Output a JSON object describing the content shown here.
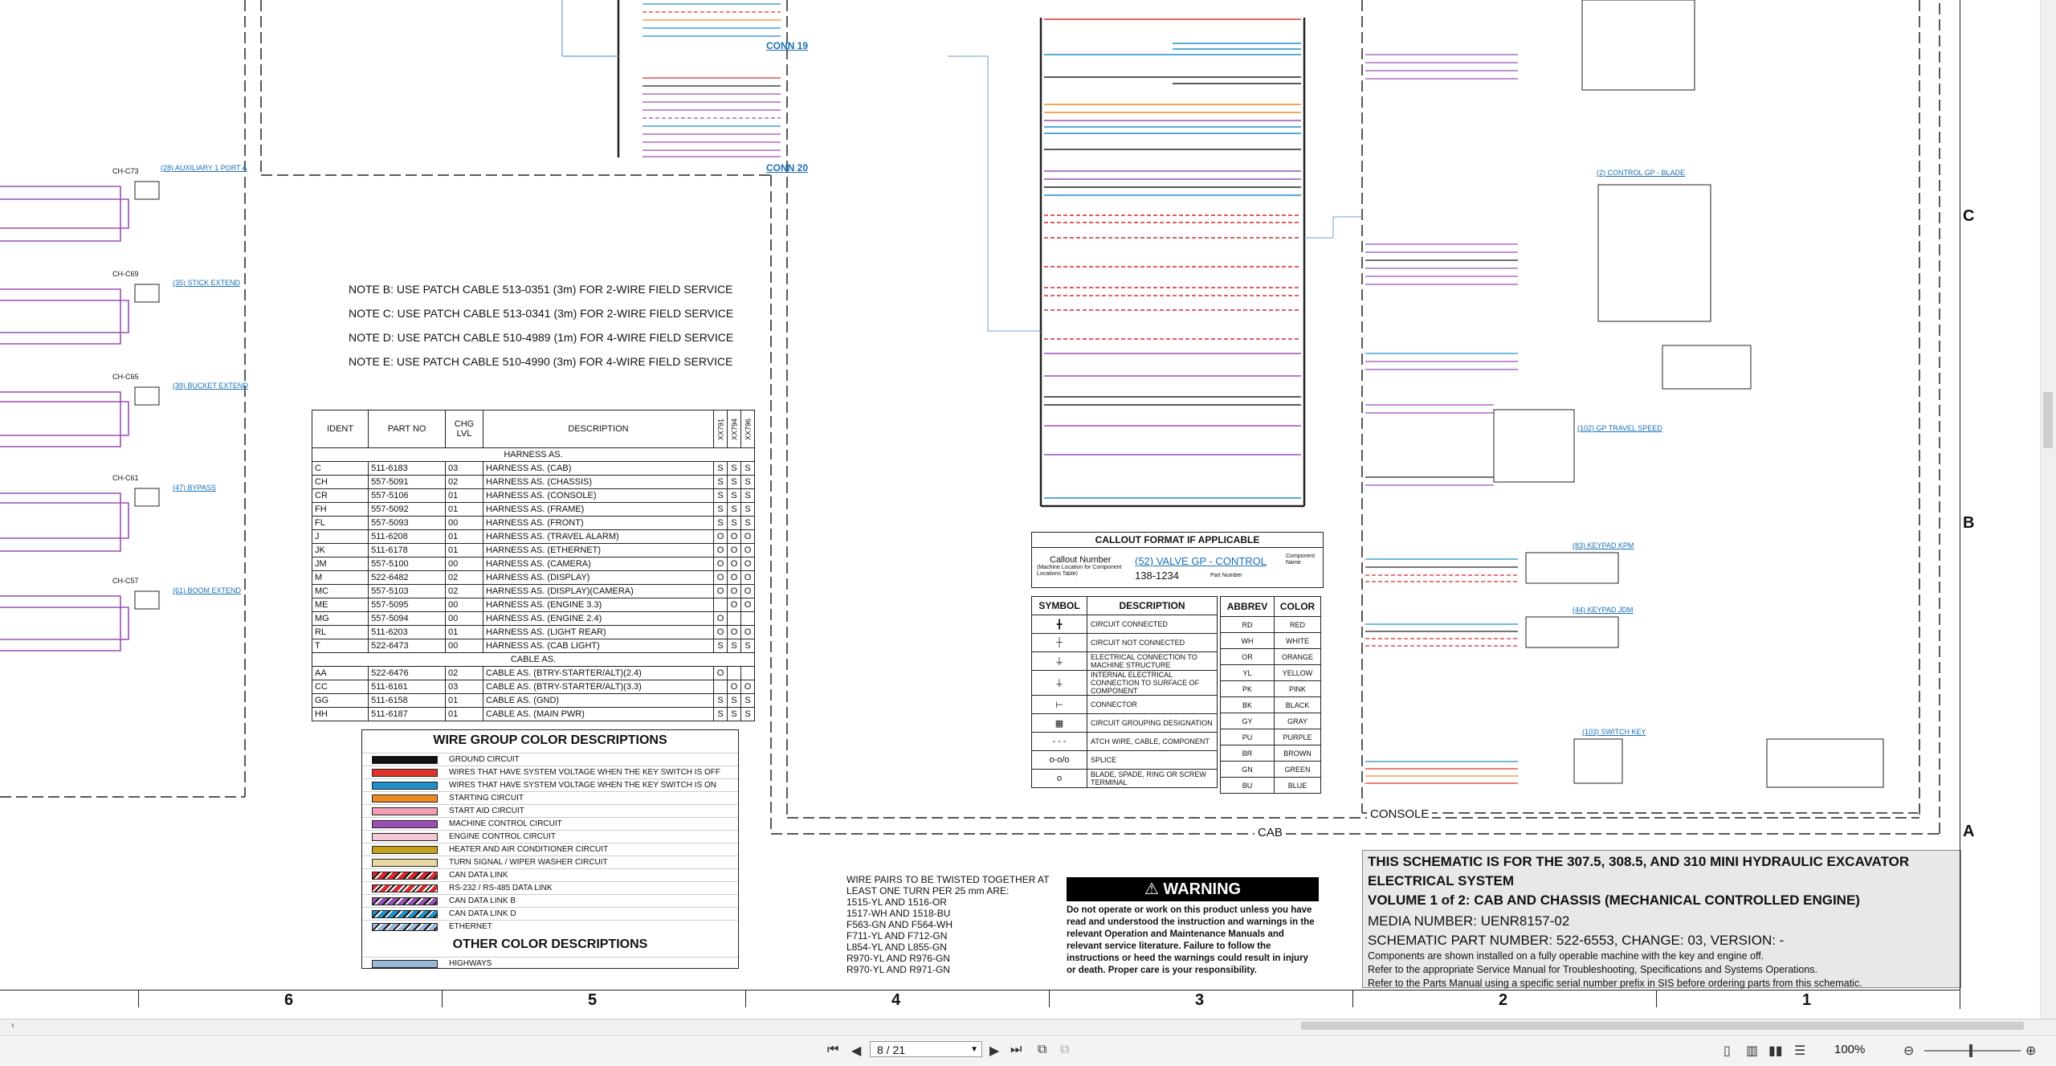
{
  "notes": [
    "NOTE B: USE PATCH CABLE 513-0351 (3m) FOR 2-WIRE FIELD SERVICE",
    "NOTE C: USE PATCH CABLE 513-0341 (3m) FOR 2-WIRE FIELD SERVICE",
    "NOTE D: USE PATCH CABLE 510-4989 (1m) FOR 4-WIRE FIELD SERVICE",
    "NOTE E: USE PATCH CABLE 510-4990 (3m) FOR 4-WIRE FIELD SERVICE"
  ],
  "parts_table": {
    "headers": [
      "IDENT",
      "PART NO",
      "CHG LVL",
      "DESCRIPTION",
      "XX791",
      "XX794",
      "XX796"
    ],
    "harness_label": "HARNESS AS.",
    "cable_label": "CABLE AS.",
    "harness_rows": [
      [
        "C",
        "511-6183",
        "03",
        "HARNESS AS. (CAB)",
        "S",
        "S",
        "S"
      ],
      [
        "CH",
        "557-5091",
        "02",
        "HARNESS AS. (CHASSIS)",
        "S",
        "S",
        "S"
      ],
      [
        "CR",
        "557-5106",
        "01",
        "HARNESS AS. (CONSOLE)",
        "S",
        "S",
        "S"
      ],
      [
        "FH",
        "557-5092",
        "01",
        "HARNESS AS. (FRAME)",
        "S",
        "S",
        "S"
      ],
      [
        "FL",
        "557-5093",
        "00",
        "HARNESS AS. (FRONT)",
        "S",
        "S",
        "S"
      ],
      [
        "J",
        "511-6208",
        "01",
        "HARNESS AS. (TRAVEL ALARM)",
        "O",
        "O",
        "O"
      ],
      [
        "JK",
        "511-6178",
        "01",
        "HARNESS AS. (ETHERNET)",
        "O",
        "O",
        "O"
      ],
      [
        "JM",
        "557-5100",
        "00",
        "HARNESS AS. (CAMERA)",
        "O",
        "O",
        "O"
      ],
      [
        "M",
        "522-6482",
        "02",
        "HARNESS AS. (DISPLAY)",
        "O",
        "O",
        "O"
      ],
      [
        "MC",
        "557-5103",
        "02",
        "HARNESS AS. (DISPLAY)(CAMERA)",
        "O",
        "O",
        "O"
      ],
      [
        "ME",
        "557-5095",
        "00",
        "HARNESS AS. (ENGINE 3.3)",
        "",
        "O",
        "O"
      ],
      [
        "MG",
        "557-5094",
        "00",
        "HARNESS AS. (ENGINE 2.4)",
        "O",
        "",
        ""
      ],
      [
        "RL",
        "511-6203",
        "01",
        "HARNESS AS. (LIGHT REAR)",
        "O",
        "O",
        "O"
      ],
      [
        "T",
        "522-6473",
        "00",
        "HARNESS AS. (CAB LIGHT)",
        "S",
        "S",
        "S"
      ]
    ],
    "cable_rows": [
      [
        "AA",
        "522-6476",
        "02",
        "CABLE AS. (BTRY-STARTER/ALT)(2.4)",
        "O",
        "",
        ""
      ],
      [
        "CC",
        "511-6161",
        "03",
        "CABLE AS. (BTRY-STARTER/ALT)(3.3)",
        "",
        "O",
        "O"
      ],
      [
        "GG",
        "511-6158",
        "01",
        "CABLE AS. (GND)",
        "S",
        "S",
        "S"
      ],
      [
        "HH",
        "511-6187",
        "01",
        "CABLE AS. (MAIN PWR)",
        "S",
        "S",
        "S"
      ]
    ]
  },
  "wire_group": {
    "title": "WIRE GROUP COLOR DESCRIPTIONS",
    "other_title": "OTHER COLOR DESCRIPTIONS",
    "items": [
      {
        "label": "GROUND CIRCUIT",
        "color": "#111111",
        "style": "solid"
      },
      {
        "label": "WIRES THAT HAVE SYSTEM VOLTAGE WHEN THE KEY SWITCH IS OFF",
        "color": "#e0322a",
        "style": "solid"
      },
      {
        "label": "WIRES THAT HAVE SYSTEM VOLTAGE WHEN THE KEY SWITCH IS ON",
        "color": "#1f8fc9",
        "style": "solid"
      },
      {
        "label": "STARTING CIRCUIT",
        "color": "#f08a24",
        "style": "solid"
      },
      {
        "label": "START AID CIRCUIT",
        "color": "#f2a0b6",
        "style": "solid"
      },
      {
        "label": "MACHINE CONTROL CIRCUIT",
        "color": "#9a4fb4",
        "style": "solid"
      },
      {
        "label": "ENGINE CONTROL CIRCUIT",
        "color": "#f6c7d6",
        "style": "solid"
      },
      {
        "label": "HEATER AND AIR CONDITIONER CIRCUIT",
        "color": "#c2a21a",
        "style": "solid"
      },
      {
        "label": "TURN SIGNAL / WIPER WASHER CIRCUIT",
        "color": "#e8d7a0",
        "style": "solid"
      },
      {
        "label": "CAN DATA LINK",
        "color": "#d9262b",
        "style": "hatch"
      },
      {
        "label": "RS-232 / RS-485 DATA LINK",
        "color": "#d9262b",
        "style": "hatch2"
      },
      {
        "label": "CAN DATA LINK B",
        "color": "#9a4fb4",
        "style": "hatch"
      },
      {
        "label": "CAN DATA LINK D",
        "color": "#1f8fc9",
        "style": "hatch"
      },
      {
        "label": "ETHERNET",
        "color": "#9bb8d9",
        "style": "hatch"
      }
    ],
    "other_items": [
      {
        "label": "HIGHWAYS",
        "color": "#9bb8d9",
        "style": "solid"
      }
    ]
  },
  "twist_note": [
    "WIRE PAIRS TO BE TWISTED TOGETHER AT",
    "LEAST ONE TURN PER 25 mm ARE:",
    "1515-YL AND 1516-OR",
    "1517-WH AND 1518-BU",
    "F563-GN AND F564-WH",
    "F711-YL AND F712-GN",
    "L854-YL AND L855-GN",
    "R970-YL AND R976-GN",
    "R970-YL AND R971-GN"
  ],
  "callout": {
    "title": "CALLOUT FORMAT IF APPLICABLE",
    "callout_number": "Callout Number",
    "callout_sub": "(Machine Location for Component Locations Table)",
    "example_link": "(52) VALVE GP - CONTROL",
    "component_name": "Component Name",
    "part_number_example": "138-1234",
    "part_number_label": "Part Number"
  },
  "symbol_table": {
    "headers": [
      "SYMBOL",
      "DESCRIPTION"
    ],
    "rows": [
      {
        "glyph": "╋",
        "desc": "CIRCUIT CONNECTED"
      },
      {
        "glyph": "┼",
        "desc": "CIRCUIT NOT CONNECTED"
      },
      {
        "glyph": "⏚",
        "desc": "ELECTRICAL CONNECTION TO MACHINE STRUCTURE"
      },
      {
        "glyph": "⏚",
        "desc": "INTERNAL ELECTRICAL CONNECTION TO SURFACE OF COMPONENT"
      },
      {
        "glyph": "⊢",
        "desc": "CONNECTOR"
      },
      {
        "glyph": "▦",
        "desc": "CIRCUIT GROUPING DESIGNATION"
      },
      {
        "glyph": "- - -",
        "desc": "ATCH WIRE, CABLE, COMPONENT"
      },
      {
        "glyph": "o-o/o",
        "desc": "SPLICE"
      },
      {
        "glyph": "o",
        "desc": "BLADE, SPADE, RING OR SCREW TERMINAL"
      }
    ]
  },
  "abbrev_table": {
    "headers": [
      "ABBREV",
      "COLOR"
    ],
    "rows": [
      [
        "RD",
        "RED"
      ],
      [
        "WH",
        "WHITE"
      ],
      [
        "OR",
        "ORANGE"
      ],
      [
        "YL",
        "YELLOW"
      ],
      [
        "PK",
        "PINK"
      ],
      [
        "BK",
        "BLACK"
      ],
      [
        "GY",
        "GRAY"
      ],
      [
        "PU",
        "PURPLE"
      ],
      [
        "BR",
        "BROWN"
      ],
      [
        "GN",
        "GREEN"
      ],
      [
        "BU",
        "BLUE"
      ]
    ]
  },
  "warning": {
    "title": "WARNING",
    "body": "Do not operate or work on this product unless you have read and understood the instruction and warnings in the relevant Operation and Maintenance Manuals and relevant service literature. Failure to follow the instructions or heed the warnings could result in injury or death. Proper care is your responsibility."
  },
  "title_block": {
    "line1": "THIS SCHEMATIC IS FOR THE 307.5, 308.5, AND 310 MINI HYDRAULIC EXCAVATOR",
    "line2": "ELECTRICAL SYSTEM",
    "line3": "VOLUME 1 of 2: CAB AND CHASSIS (MECHANICAL CONTROLLED ENGINE)",
    "media": "MEDIA NUMBER: UENR8157-02",
    "schematic": "SCHEMATIC PART NUMBER: 522-6553, CHANGE: 03, VERSION: -",
    "note1": "Components are shown installed on a fully operable machine with the key and engine off.",
    "note2": "Refer to the appropriate Service Manual for Troubleshooting, Specifications and Systems Operations.",
    "note3": "Refer to the Parts Manual using a specific serial number prefix in SIS before ordering parts from this schematic."
  },
  "zone_labels": {
    "cab": "CAB",
    "console": "CONSOLE",
    "conn19": "CONN 19",
    "conn20": "CONN 20"
  },
  "ruler_numbers": [
    "6",
    "5",
    "4",
    "3",
    "2",
    "1"
  ],
  "ruler_letters": [
    "C",
    "B",
    "A"
  ],
  "left_links": [
    "(28) AUXILIARY 1 PORT A",
    "(35) STICK EXTEND",
    "(39) BUCKET EXTEND",
    "(47) BYPASS",
    "(61) BOOM EXTEND"
  ],
  "left_conn": [
    "CH-C73",
    "CH-C69",
    "CH-C65",
    "CH-C61",
    "CH-C57"
  ],
  "right_links": [
    "(2) CONTROL GP - BLADE",
    "(102) GP TRAVEL SPEED",
    "(83) KEYPAD KPM",
    "(44) KEYPAD JDM",
    "(103) SWITCH KEY"
  ],
  "viewer": {
    "page_display": "8 / 21",
    "zoom": "100%"
  }
}
